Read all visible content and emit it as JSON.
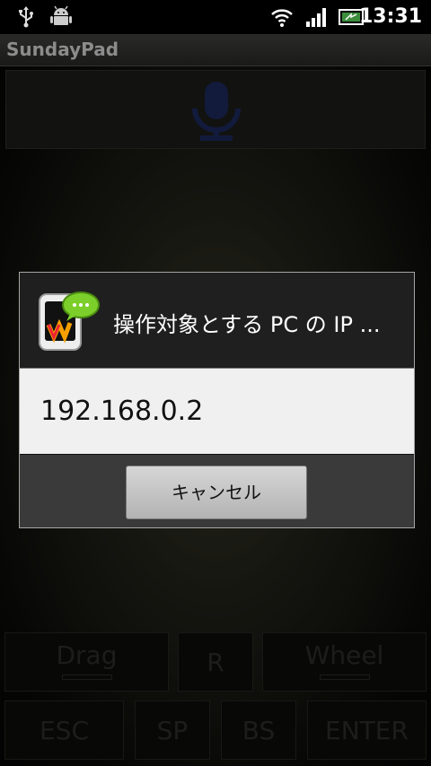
{
  "status_bar": {
    "time": "13:31",
    "icons": [
      "usb-icon",
      "android-debug-icon",
      "wifi-icon",
      "signal-icon",
      "battery-icon"
    ]
  },
  "app": {
    "title": "SundayPad"
  },
  "mic_panel": {
    "icon": "microphone-icon"
  },
  "dialog": {
    "title": "操作対象とする PC の IP ...",
    "items": [
      "192.168.0.2"
    ],
    "cancel_label": "キャンセル",
    "app_icon": "sundaypad-app-icon"
  },
  "keys": {
    "drag": "Drag",
    "right": "R",
    "wheel": "Wheel",
    "esc": "ESC",
    "sp": "SP",
    "bs": "BS",
    "enter": "ENTER"
  },
  "colors": {
    "accent": "#1a2a5a",
    "dialog_body": "#f0f0f0",
    "dialog_footer": "#3a3a3a"
  }
}
